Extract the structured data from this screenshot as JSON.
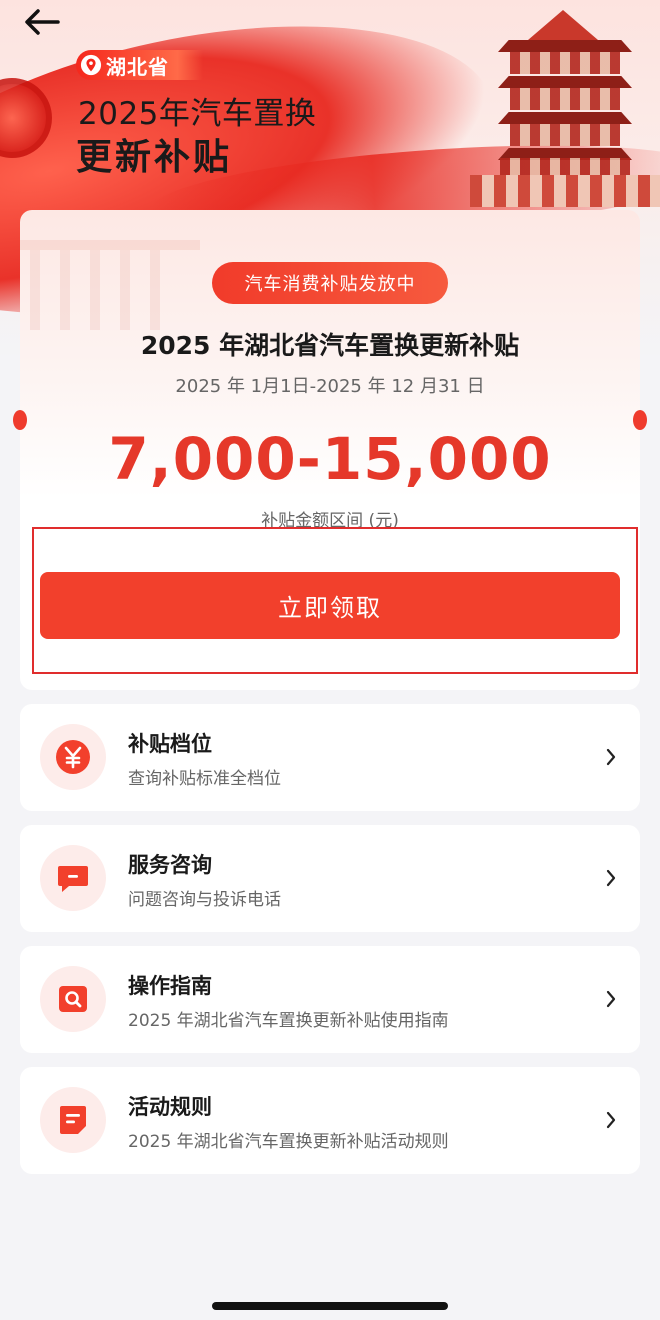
{
  "hero": {
    "region": "湖北省",
    "title_line1": "2025年汽车置换",
    "title_line2": "更新补贴"
  },
  "card": {
    "status": "汽车消费补贴发放中",
    "title": "2025 年湖北省汽车置换更新补贴",
    "period": "2025 年 1月1日-2025 年 12 月31 日",
    "amount": "7,000-15,000",
    "amount_label": "补贴金额区间 (元)",
    "claim_button": "立即领取"
  },
  "menu": [
    {
      "title": "补贴档位",
      "subtitle": "查询补贴标准全档位",
      "icon": "yuan-icon"
    },
    {
      "title": "服务咨询",
      "subtitle": "问题咨询与投诉电话",
      "icon": "chat-icon"
    },
    {
      "title": "操作指南",
      "subtitle": "2025 年湖北省汽车置换更新补贴使用指南",
      "icon": "search-icon"
    },
    {
      "title": "活动规则",
      "subtitle": "2025 年湖北省汽车置换更新补贴活动规则",
      "icon": "document-icon"
    }
  ],
  "colors": {
    "accent": "#f2402c",
    "amount": "#e5382a",
    "background": "#f4f4f7"
  }
}
